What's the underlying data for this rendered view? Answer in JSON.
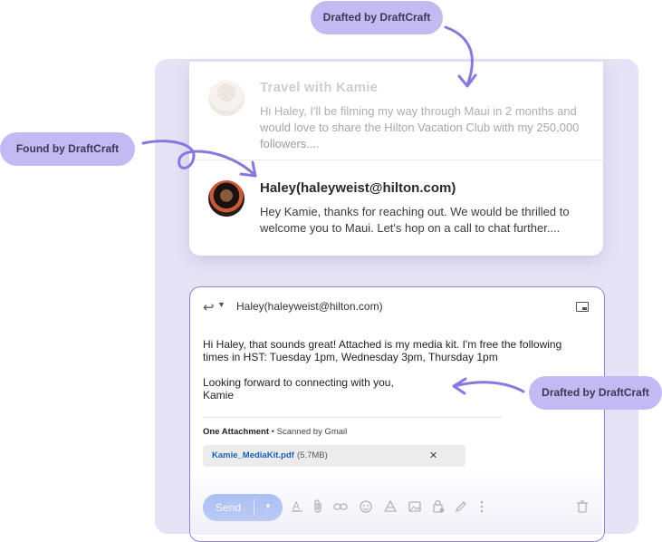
{
  "callouts": {
    "drafted_top": "Drafted by DraftCraft",
    "found": "Found by DraftCraft",
    "drafted_right": "Drafted by DraftCraft"
  },
  "thread": {
    "first": {
      "sender": "Travel with Kamie",
      "body": "Hi Haley, I'll be filming my way through Maui in 2 months and would love to share the Hilton Vacation Club with my 250,000 followers...."
    },
    "second": {
      "sender": "Haley(haleyweist@hilton.com)",
      "body": "Hey Kamie, thanks for reaching out. We would be thrilled to welcome you to Maui. Let's hop on a call to chat further...."
    }
  },
  "reply": {
    "to": "Haley(haleyweist@hilton.com)",
    "message": "Hi Haley, that sounds great! Attached is my media kit. I'm free the following times in HST: Tuesday 1pm, Wednesday 3pm, Thursday 1pm",
    "closing_line1": "Looking forward to connecting with you,",
    "closing_line2": "Kamie",
    "attachment_count_label": "One Attachment",
    "scan_label": "• Scanned by Gmail",
    "attachment_name": "Kamie_MediaKit.pdf",
    "attachment_size": "(5.7MB)",
    "send_label": "Send"
  },
  "toolbar_icons": [
    "format-text-icon",
    "attach-icon",
    "link-icon",
    "emoji-icon",
    "drive-icon",
    "photo-icon",
    "lock-icon",
    "signature-icon",
    "more-icon",
    "trash-icon"
  ],
  "colors": {
    "accent": "#c3b9f3",
    "arrow": "#8a77dd",
    "panel": "#e6e3f6",
    "send_button": "#9ab6f2",
    "link": "#1a5fb4"
  }
}
